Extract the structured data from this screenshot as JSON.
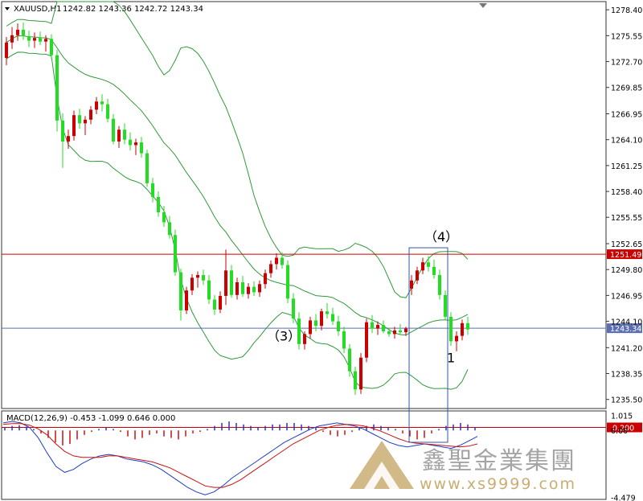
{
  "chart_data": [
    {
      "type": "candlestick",
      "title": "XAUUSD,H1",
      "ohlc_header": "1242.82 1243.36 1242.72 1243.34",
      "y_tick_labels": [
        "1278.40",
        "1275.55",
        "1272.70",
        "1269.85",
        "1266.95",
        "1264.10",
        "1261.25",
        "1258.40",
        "1255.55",
        "1252.65",
        "1249.80",
        "1246.95",
        "1244.10",
        "1241.20",
        "1238.35",
        "1235.50"
      ],
      "ylim": [
        1234.5,
        1279.3
      ],
      "hlines": [
        {
          "price": 1251.49,
          "label": "1251.49",
          "color": "#cc0000"
        },
        {
          "price": 1243.34,
          "label": "1243.34",
          "color": "#5b6fb0"
        }
      ],
      "annotations": [
        {
          "text": "（4）",
          "bar": 76,
          "price": 1252.9
        },
        {
          "text": "（3）",
          "bar": 48,
          "price": 1242.0
        },
        {
          "text": "1",
          "bar": 80,
          "price": 1239.6
        }
      ],
      "highlight_box": {
        "bar_from": 72,
        "bar_to": 78,
        "price_top": 1252.2
      },
      "candles": [
        [
          1273.1,
          1275.4,
          1272.3,
          1274.8
        ],
        [
          1274.8,
          1276.5,
          1274.1,
          1275.6
        ],
        [
          1275.6,
          1276.9,
          1275.0,
          1276.2
        ],
        [
          1276.2,
          1277.0,
          1275.1,
          1275.5
        ],
        [
          1275.5,
          1276.1,
          1274.3,
          1275.0
        ],
        [
          1275.0,
          1275.9,
          1274.2,
          1275.3
        ],
        [
          1275.3,
          1276.0,
          1274.5,
          1274.9
        ],
        [
          1274.9,
          1275.6,
          1273.8,
          1275.2
        ],
        [
          1275.2,
          1275.7,
          1273.0,
          1273.4
        ],
        [
          1273.4,
          1274.0,
          1265.0,
          1266.2
        ],
        [
          1266.2,
          1267.0,
          1261.0,
          1263.9
        ],
        [
          1263.9,
          1265.2,
          1263.1,
          1264.5
        ],
        [
          1264.5,
          1267.3,
          1264.0,
          1266.8
        ],
        [
          1266.8,
          1267.5,
          1265.3,
          1265.9
        ],
        [
          1265.9,
          1266.7,
          1264.6,
          1266.3
        ],
        [
          1266.3,
          1267.8,
          1265.8,
          1267.4
        ],
        [
          1267.4,
          1268.8,
          1266.9,
          1268.3
        ],
        [
          1268.3,
          1269.1,
          1267.2,
          1268.0
        ],
        [
          1268.0,
          1268.6,
          1266.0,
          1266.4
        ],
        [
          1266.4,
          1266.9,
          1263.6,
          1263.9
        ],
        [
          1263.9,
          1265.6,
          1263.2,
          1265.2
        ],
        [
          1265.2,
          1265.9,
          1263.6,
          1264.1
        ],
        [
          1264.1,
          1264.9,
          1262.9,
          1263.5
        ],
        [
          1263.5,
          1264.2,
          1262.4,
          1263.8
        ],
        [
          1263.8,
          1264.4,
          1262.1,
          1262.6
        ],
        [
          1262.6,
          1263.0,
          1258.9,
          1259.3
        ],
        [
          1259.3,
          1259.9,
          1257.2,
          1257.8
        ],
        [
          1257.8,
          1258.4,
          1255.6,
          1256.1
        ],
        [
          1256.1,
          1256.8,
          1254.5,
          1255.0
        ],
        [
          1255.0,
          1255.7,
          1253.2,
          1253.6
        ],
        [
          1253.6,
          1254.2,
          1249.1,
          1249.5
        ],
        [
          1249.5,
          1249.9,
          1244.2,
          1245.3
        ],
        [
          1245.3,
          1247.9,
          1244.9,
          1247.5
        ],
        [
          1247.5,
          1249.3,
          1247.0,
          1248.9
        ],
        [
          1248.9,
          1249.6,
          1247.8,
          1249.2
        ],
        [
          1249.2,
          1249.8,
          1248.1,
          1248.6
        ],
        [
          1248.6,
          1249.2,
          1246.0,
          1246.5
        ],
        [
          1246.5,
          1247.0,
          1244.8,
          1245.4
        ],
        [
          1245.4,
          1247.4,
          1245.0,
          1246.9
        ],
        [
          1246.9,
          1252.0,
          1245.9,
          1249.7
        ],
        [
          1249.7,
          1250.3,
          1246.7,
          1247.0
        ],
        [
          1247.0,
          1248.9,
          1246.5,
          1248.4
        ],
        [
          1248.4,
          1249.1,
          1246.8,
          1247.1
        ],
        [
          1247.1,
          1248.3,
          1246.6,
          1247.9
        ],
        [
          1247.9,
          1248.5,
          1246.9,
          1247.3
        ],
        [
          1247.3,
          1248.6,
          1246.8,
          1248.2
        ],
        [
          1248.2,
          1249.8,
          1247.7,
          1249.4
        ],
        [
          1249.4,
          1250.8,
          1248.9,
          1250.4
        ],
        [
          1250.4,
          1251.6,
          1249.8,
          1251.1
        ],
        [
          1251.1,
          1251.7,
          1249.9,
          1250.3
        ],
        [
          1250.3,
          1250.8,
          1246.1,
          1246.6
        ],
        [
          1246.6,
          1247.2,
          1243.9,
          1244.4
        ],
        [
          1244.4,
          1245.1,
          1241.0,
          1241.6
        ],
        [
          1241.6,
          1243.0,
          1241.0,
          1242.7
        ],
        [
          1242.7,
          1244.6,
          1242.2,
          1244.2
        ],
        [
          1244.2,
          1244.9,
          1243.0,
          1243.6
        ],
        [
          1243.6,
          1245.5,
          1243.1,
          1245.2
        ],
        [
          1245.2,
          1246.1,
          1244.4,
          1244.9
        ],
        [
          1244.9,
          1245.6,
          1243.7,
          1244.1
        ],
        [
          1244.1,
          1244.7,
          1242.5,
          1243.0
        ],
        [
          1243.0,
          1243.5,
          1240.6,
          1241.1
        ],
        [
          1241.1,
          1241.6,
          1238.0,
          1238.6
        ],
        [
          1238.6,
          1239.1,
          1236.0,
          1236.6
        ],
        [
          1236.6,
          1240.6,
          1236.1,
          1240.1
        ],
        [
          1240.1,
          1244.4,
          1239.6,
          1244.0
        ],
        [
          1244.0,
          1244.8,
          1242.8,
          1243.3
        ],
        [
          1243.3,
          1244.1,
          1242.6,
          1243.7
        ],
        [
          1243.7,
          1244.2,
          1242.8,
          1243.0
        ],
        [
          1243.0,
          1243.4,
          1242.4,
          1242.7
        ],
        [
          1242.7,
          1243.5,
          1242.2,
          1243.1
        ],
        [
          1243.1,
          1243.8,
          1242.6,
          1242.9
        ],
        [
          1242.9,
          1243.5,
          1242.5,
          1243.3
        ],
        [
          1247.7,
          1249.2,
          1247.0,
          1248.6
        ],
        [
          1248.6,
          1250.1,
          1248.2,
          1249.7
        ],
        [
          1249.7,
          1251.1,
          1249.3,
          1250.6
        ],
        [
          1250.6,
          1251.3,
          1249.6,
          1250.1
        ],
        [
          1250.1,
          1250.9,
          1248.8,
          1249.2
        ],
        [
          1249.2,
          1249.8,
          1246.5,
          1247.0
        ],
        [
          1247.0,
          1247.5,
          1244.2,
          1244.6
        ],
        [
          1244.6,
          1245.1,
          1241.4,
          1241.9
        ],
        [
          1241.9,
          1243.0,
          1240.8,
          1242.5
        ],
        [
          1242.5,
          1244.3,
          1242.0,
          1243.9
        ],
        [
          1243.9,
          1244.6,
          1242.6,
          1243.2
        ]
      ],
      "indicators": [
        "Bollinger Bands (upper, middle, lower)"
      ]
    },
    {
      "type": "macd",
      "title": "MACD(12,26,9) -0.453 -1.099 0.646 0.000",
      "y_tick_labels": [
        "1.015",
        "0.00",
        "-4.479"
      ],
      "ylim": [
        -4.6,
        1.3
      ],
      "hline": {
        "value": 0.2,
        "label": "0.200",
        "color": "#cc0000"
      },
      "histogram": [
        0.2,
        0.3,
        0.35,
        0.25,
        0.1,
        -0.2,
        -0.5,
        -0.8,
        -1.0,
        -0.9,
        -0.6,
        -0.3,
        -0.1,
        0.1,
        0.2,
        0.1,
        -0.1,
        -0.4,
        -0.6,
        -0.5,
        -0.3,
        -0.2,
        -0.4,
        -0.5,
        -0.6,
        -0.4,
        -0.2,
        -0.1,
        0.1,
        0.3,
        0.5,
        0.6,
        0.5,
        0.4,
        0.3,
        0.2,
        0.3,
        0.4,
        0.4,
        0.5,
        0.5,
        0.4,
        0.3,
        0.2,
        -0.1,
        -0.3,
        -0.4,
        -0.3,
        -0.1,
        0.2,
        0.3,
        0.4,
        0.3,
        0.2,
        0.1,
        -0.2,
        -0.4,
        -0.6,
        -0.5,
        -0.2,
        0.1,
        0.3,
        0.4,
        0.5,
        0.4,
        0.2
      ],
      "macd_line": [
        0.5,
        0.6,
        0.5,
        0.2,
        -0.5,
        -1.5,
        -2.4,
        -2.8,
        -2.6,
        -2.2,
        -1.9,
        -1.7,
        -1.6,
        -1.7,
        -1.9,
        -2.0,
        -2.1,
        -2.3,
        -2.6,
        -3.0,
        -3.4,
        -3.8,
        -4.1,
        -4.3,
        -4.1,
        -3.7,
        -3.2,
        -2.8,
        -2.4,
        -2.0,
        -1.6,
        -1.2,
        -0.8,
        -0.5,
        -0.2,
        0.1,
        0.3,
        0.4,
        0.5,
        0.4,
        0.3,
        0.1,
        -0.2,
        -0.5,
        -0.8,
        -1.0,
        -1.1,
        -1.0,
        -0.9,
        -1.0,
        -1.1,
        -1.2,
        -1.0,
        -0.7,
        -0.4
      ],
      "signal_line": [
        0.4,
        0.45,
        0.45,
        0.35,
        0.1,
        -0.3,
        -0.9,
        -1.4,
        -1.7,
        -1.8,
        -1.8,
        -1.8,
        -1.7,
        -1.7,
        -1.8,
        -1.9,
        -2.0,
        -2.1,
        -2.3,
        -2.5,
        -2.8,
        -3.1,
        -3.4,
        -3.7,
        -3.8,
        -3.8,
        -3.6,
        -3.3,
        -2.9,
        -2.5,
        -2.1,
        -1.7,
        -1.3,
        -0.9,
        -0.6,
        -0.3,
        0.0,
        0.2,
        0.35,
        0.4,
        0.38,
        0.3,
        0.15,
        -0.05,
        -0.3,
        -0.55,
        -0.75,
        -0.85,
        -0.9,
        -0.95,
        -1.0,
        -1.05,
        -1.1,
        -1.05,
        -0.9
      ]
    }
  ],
  "watermark": {
    "cn": "鑫聖金業集團",
    "url": "www.xs9999.com"
  },
  "colors": {
    "bull": "#cc0000",
    "bear": "#22dd22",
    "bands": "#2e9a3a",
    "macd_line": "#1f3ec4",
    "signal_line": "#cc1111",
    "hist_pos": "#2233cc",
    "hist_neg": "#cc1111",
    "grid_frame": "#333333",
    "box": "#3355aa",
    "logo": "#c9ae73",
    "watermark_text": "#9b9b9b"
  }
}
